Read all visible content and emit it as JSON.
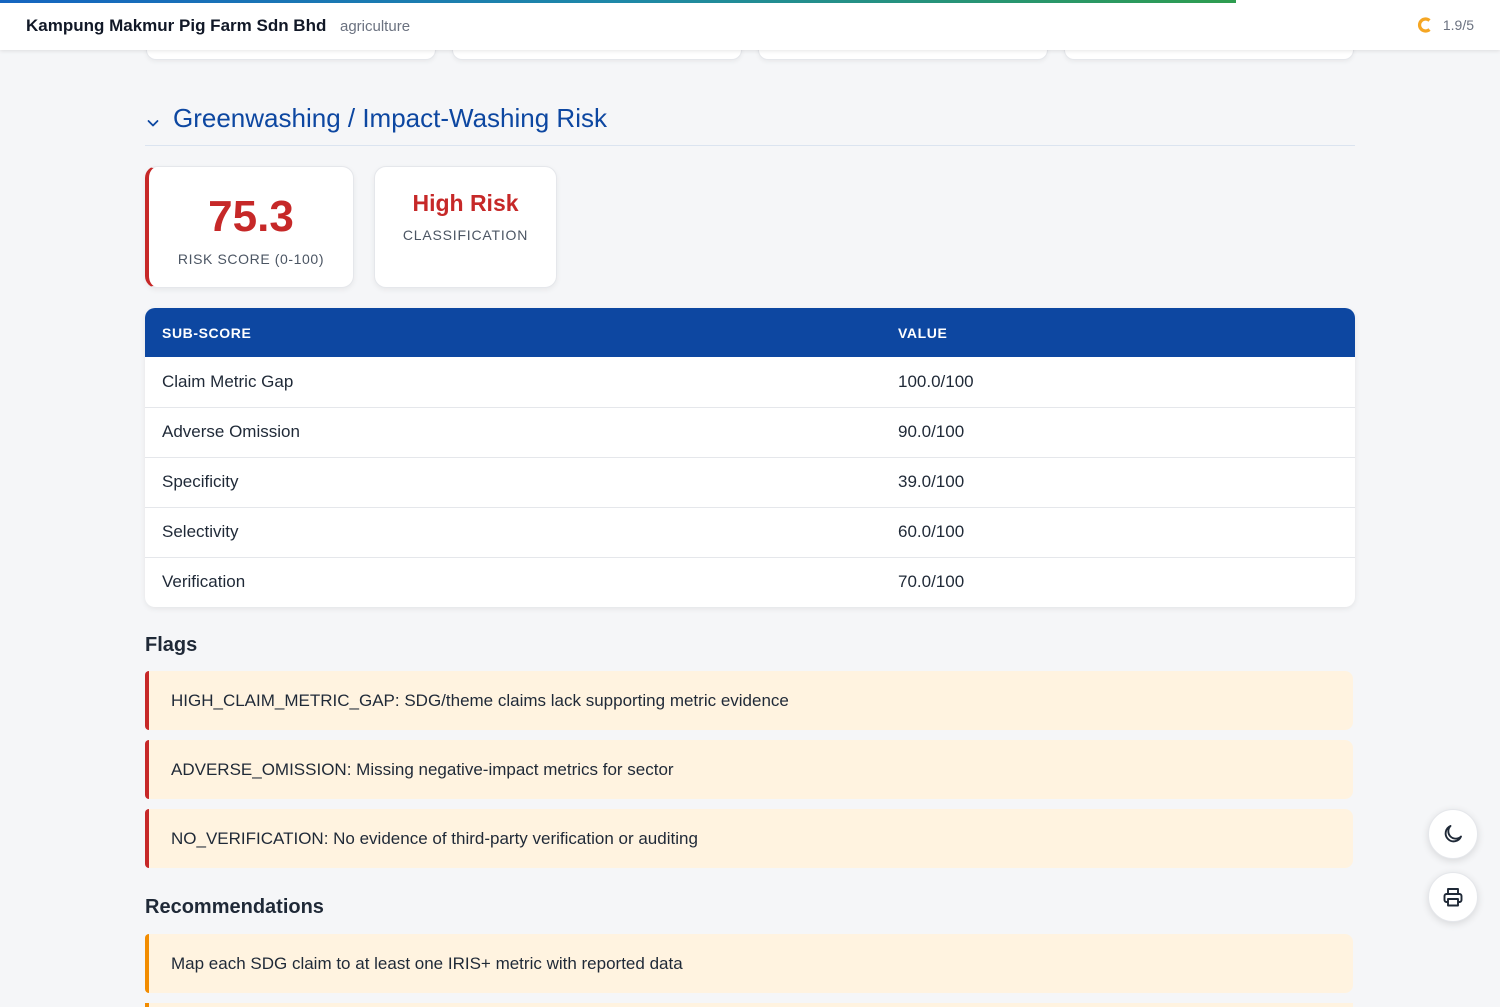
{
  "header": {
    "company": "Kampung Makmur Pig Farm Sdn Bhd",
    "sector": "agriculture",
    "rating": "1.9/5",
    "rating_icon": "partial-circle-icon",
    "load_progress": 0.824
  },
  "section": {
    "title": "Greenwashing / Impact-Washing Risk",
    "collapse_icon": "chevron-down-icon"
  },
  "score_card": {
    "value": "75.3",
    "label": "RISK SCORE (0-100)"
  },
  "classification_card": {
    "value": "High Risk",
    "label": "CLASSIFICATION"
  },
  "table": {
    "headers": [
      "SUB-SCORE",
      "VALUE"
    ],
    "rows": [
      {
        "name": "Claim Metric Gap",
        "value": "100.0/100"
      },
      {
        "name": "Adverse Omission",
        "value": "90.0/100"
      },
      {
        "name": "Specificity",
        "value": "39.0/100"
      },
      {
        "name": "Selectivity",
        "value": "60.0/100"
      },
      {
        "name": "Verification",
        "value": "70.0/100"
      }
    ]
  },
  "flags": {
    "heading": "Flags",
    "items": [
      "HIGH_CLAIM_METRIC_GAP: SDG/theme claims lack supporting metric evidence",
      "ADVERSE_OMISSION: Missing negative-impact metrics for sector",
      "NO_VERIFICATION: No evidence of third-party verification or auditing"
    ]
  },
  "recommendations": {
    "heading": "Recommendations",
    "items": [
      "Map each SDG claim to at least one IRIS+ metric with reported data"
    ]
  },
  "actions": {
    "theme_toggle_icon": "moon-icon",
    "print_icon": "printer-icon"
  },
  "colors": {
    "primary": "#0d47a1",
    "danger": "#c62828",
    "warning": "#f28c00",
    "flag_background": "#fff3e0"
  }
}
